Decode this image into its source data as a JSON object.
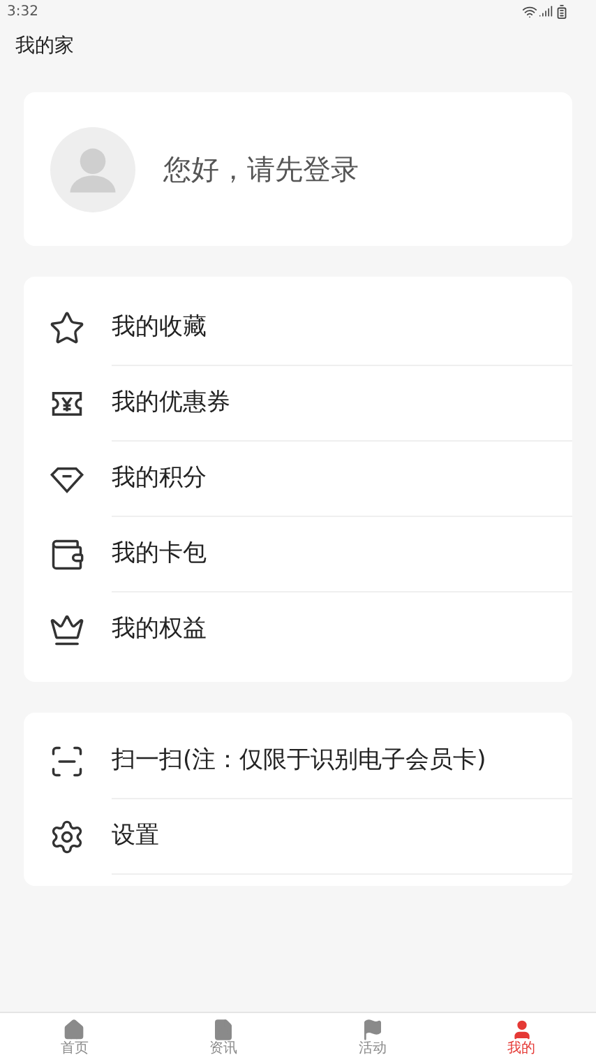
{
  "status_bar": {
    "time": "3:32"
  },
  "header": {
    "title": "我的家"
  },
  "profile": {
    "greeting": "您好，请先登录"
  },
  "menu": [
    {
      "label": "我的收藏"
    },
    {
      "label": "我的优惠券"
    },
    {
      "label": "我的积分"
    },
    {
      "label": "我的卡包"
    },
    {
      "label": "我的权益"
    }
  ],
  "tools": [
    {
      "label": "扫一扫(注：仅限于识别电子会员卡)"
    },
    {
      "label": "设置"
    }
  ],
  "tab_bar": [
    {
      "label": "首页",
      "selected": false
    },
    {
      "label": "资讯",
      "selected": false
    },
    {
      "label": "活动",
      "selected": false
    },
    {
      "label": "我的",
      "selected": true
    }
  ]
}
